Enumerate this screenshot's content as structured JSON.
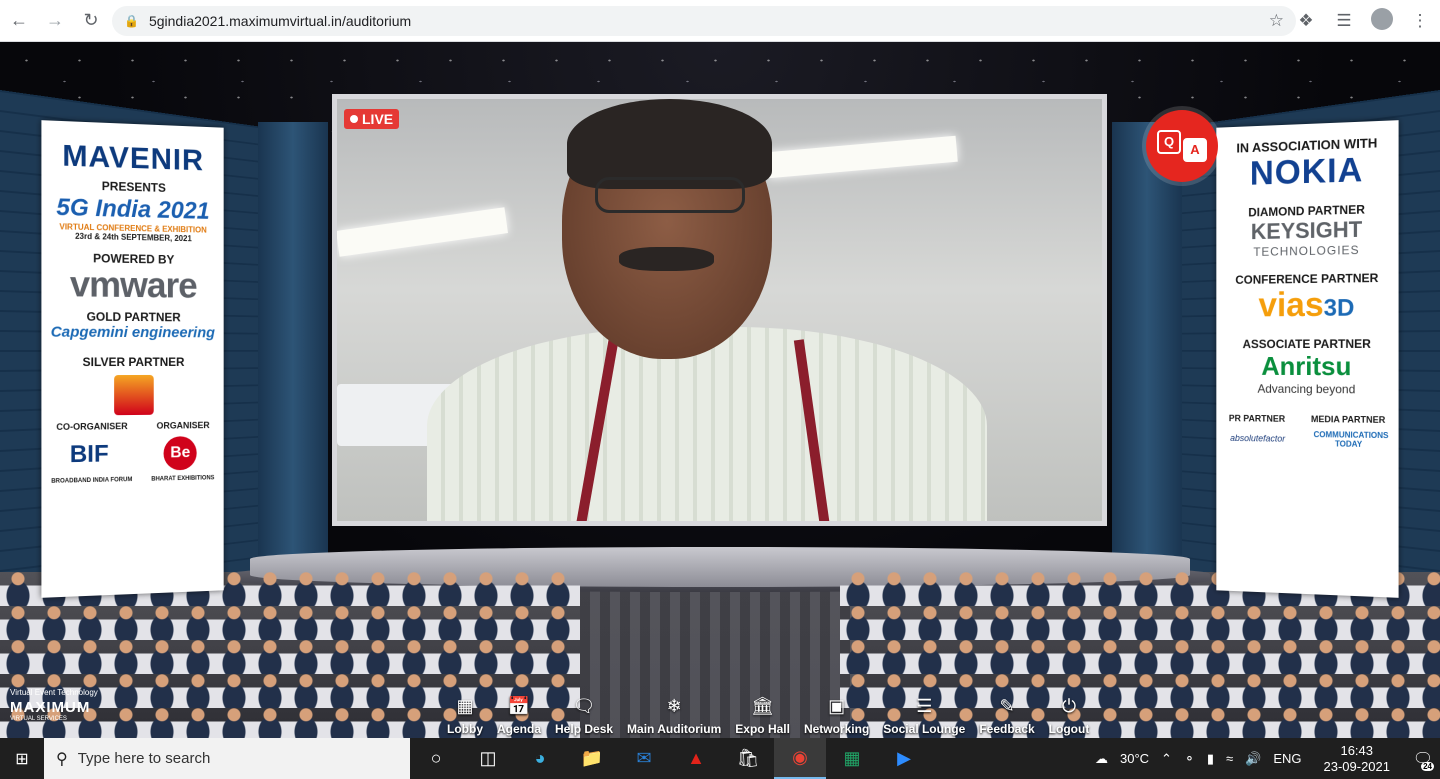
{
  "browser": {
    "url": "5gindia2021.maximumvirtual.in/auditorium"
  },
  "video": {
    "live_label": "LIVE"
  },
  "left_banner": {
    "brand": "MAVENIR",
    "presents": "PRESENTS",
    "event_title": "5G India 2021",
    "event_sub": "VIRTUAL CONFERENCE & EXHIBITION",
    "event_dates": "23rd & 24th SEPTEMBER, 2021",
    "powered_by": "POWERED BY",
    "powered_logo": "vmware",
    "gold_partner": "GOLD PARTNER",
    "gold_logo": "Capgemini engineering",
    "silver_partner": "SILVER PARTNER",
    "co_organiser": "CO-ORGANISER",
    "co_organiser_logo": "BIF",
    "co_organiser_sub": "BROADBAND INDIA FORUM",
    "organiser": "ORGANISER",
    "organiser_logo": "Be",
    "organiser_sub": "BHARAT EXHIBITIONS"
  },
  "right_banner": {
    "in_association": "IN ASSOCIATION WITH",
    "association_logo": "NOKIA",
    "diamond_partner": "DIAMOND PARTNER",
    "diamond_logo": "KEYSIGHT",
    "diamond_sub": "TECHNOLOGIES",
    "conference_partner": "CONFERENCE PARTNER",
    "conference_logo": "vias",
    "conference_logo_suffix": "3D",
    "associate_partner": "ASSOCIATE PARTNER",
    "associate_logo": "Anritsu",
    "associate_sub": "Advancing beyond",
    "pr_partner": "PR PARTNER",
    "pr_logo": "absolutefactor",
    "media_partner": "MEDIA PARTNER",
    "media_logo": "COMMUNICATIONS TODAY"
  },
  "event_logo": {
    "line1": "Virtual Event Technology",
    "line2": "MAXIMUM",
    "line3": "VIRTUAL SERVICES"
  },
  "bottom_nav": [
    {
      "label": "Lobby",
      "icon": "grid-icon"
    },
    {
      "label": "Agenda",
      "icon": "calendar-icon"
    },
    {
      "label": "Help Desk",
      "icon": "chat-icon"
    },
    {
      "label": "Main Auditorium",
      "icon": "snowflake-icon"
    },
    {
      "label": "Expo Hall",
      "icon": "building-icon"
    },
    {
      "label": "Networking",
      "icon": "card-icon"
    },
    {
      "label": "Social Lounge",
      "icon": "stack-icon"
    },
    {
      "label": "Feedback",
      "icon": "pen-icon"
    },
    {
      "label": "Logout",
      "icon": "power-icon"
    }
  ],
  "taskbar": {
    "search_placeholder": "Type here to search",
    "weather": "30°C",
    "language": "ENG",
    "time": "16:43",
    "date": "23-09-2021",
    "notification_count": "24"
  }
}
